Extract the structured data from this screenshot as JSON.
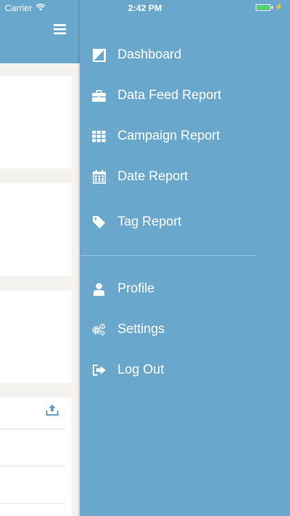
{
  "status_bar": {
    "carrier": "Carrier",
    "time": "2:42 PM",
    "battery_level": 1.0,
    "battery_color": "#4cd964"
  },
  "colors": {
    "accent": "#6aa7cc",
    "background": "#f3f2ee",
    "text": "#ffffff"
  },
  "header": {
    "menu_icon": "hamburger-icon"
  },
  "content": {
    "upload_icon": "upload-icon"
  },
  "menu": {
    "items": [
      {
        "label": "Dashboard",
        "icon": "dashboard-icon"
      },
      {
        "label": "Data Feed Report",
        "icon": "briefcase-icon"
      },
      {
        "label": "Campaign Report",
        "icon": "grid-icon"
      },
      {
        "label": "Date Report",
        "icon": "calendar-icon"
      },
      {
        "label": "Tag Report",
        "icon": "tag-icon"
      }
    ],
    "secondary_items": [
      {
        "label": "Profile",
        "icon": "user-icon"
      },
      {
        "label": "Settings",
        "icon": "gears-icon"
      },
      {
        "label": "Log Out",
        "icon": "logout-icon"
      }
    ]
  }
}
